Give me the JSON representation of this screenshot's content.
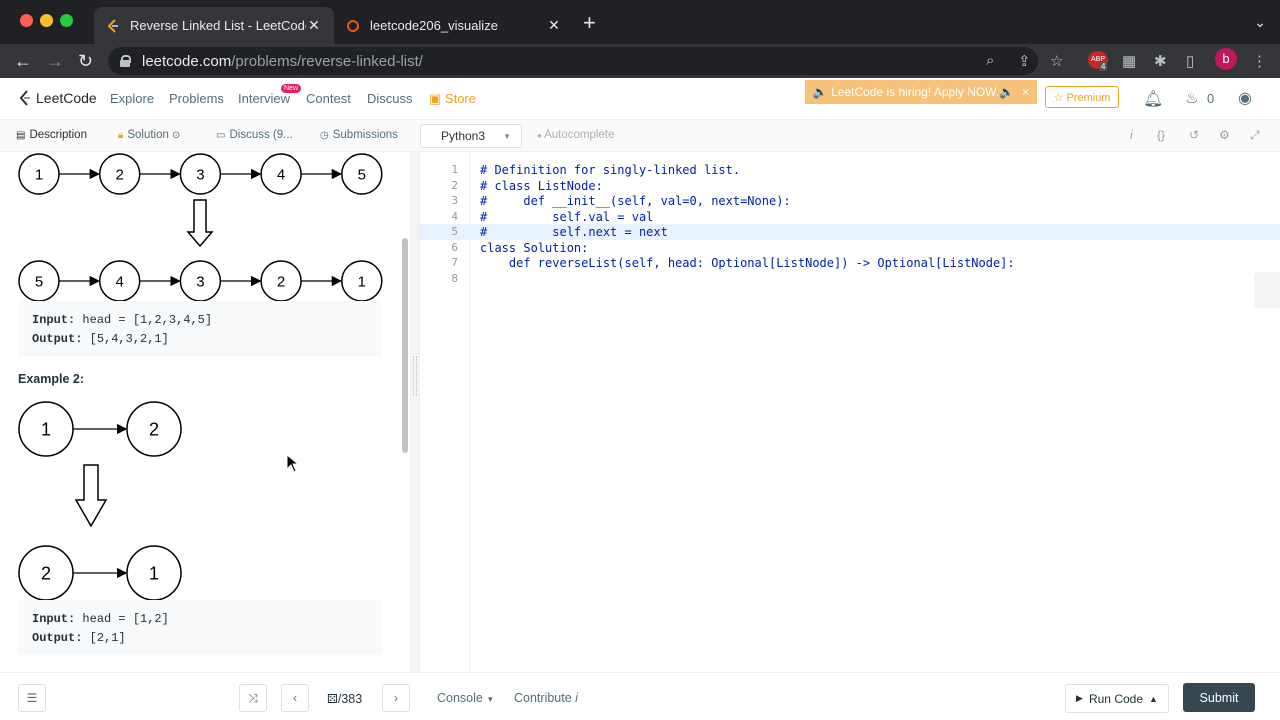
{
  "browser": {
    "tabs": [
      {
        "title": "Reverse Linked List - LeetCode",
        "active": true
      },
      {
        "title": "leetcode206_visualize",
        "active": false
      }
    ],
    "url_host": "leetcode.com",
    "url_path": "/problems/reverse-linked-list/",
    "avatar_letter": "b",
    "ext_badge": "4"
  },
  "header": {
    "logo": "LeetCode",
    "nav": [
      "Explore",
      "Problems",
      "Interview",
      "Contest",
      "Discuss",
      "Store"
    ],
    "new_badge": "New",
    "hiring_banner": "🔈 LeetCode is hiring! Apply NOW.🔈",
    "hiring_close": "×",
    "premium": "☆ Premium",
    "streak_count": "0"
  },
  "subtabs": {
    "description": "Description",
    "solution": "Solution",
    "discuss": "Discuss (9...",
    "submissions": "Submissions",
    "language": "Python3",
    "autocomplete": "Autocomplete"
  },
  "problem": {
    "example1": {
      "original": [
        "1",
        "2",
        "3",
        "4",
        "5"
      ],
      "reversed": [
        "5",
        "4",
        "3",
        "2",
        "1"
      ],
      "input_label": "Input:",
      "input_value": "head = [1,2,3,4,5]",
      "output_label": "Output:",
      "output_value": "[5,4,3,2,1]"
    },
    "example2": {
      "title": "Example 2:",
      "original": [
        "1",
        "2"
      ],
      "reversed": [
        "2",
        "1"
      ],
      "input_label": "Input:",
      "input_value": "head = [1,2]",
      "output_label": "Output:",
      "output_value": "[2,1]"
    }
  },
  "editor": {
    "lines": [
      {
        "n": "1",
        "text": "# Definition for singly-linked list."
      },
      {
        "n": "2",
        "text": "# class ListNode:"
      },
      {
        "n": "3",
        "text": "#     def __init__(self, val=0, next=None):"
      },
      {
        "n": "4",
        "text": "#         self.val = val"
      },
      {
        "n": "5",
        "text": "#         self.next = next"
      },
      {
        "n": "6",
        "text": "class Solution:"
      },
      {
        "n": "7",
        "text": "    def reverseList(self, head: Optional[ListNode]) -> Optional[ListNode]:"
      },
      {
        "n": "8",
        "text": ""
      }
    ],
    "highlighted_line": "5"
  },
  "bottom": {
    "page_counter": "/383",
    "console": "Console",
    "contribute": "Contribute",
    "run_code": "Run Code",
    "submit": "Submit"
  },
  "colors": {
    "accent": "#f0a020",
    "submit_bg": "#37474f",
    "new_badge": "#e91e63",
    "hiring_bg": "#f6c27a"
  }
}
